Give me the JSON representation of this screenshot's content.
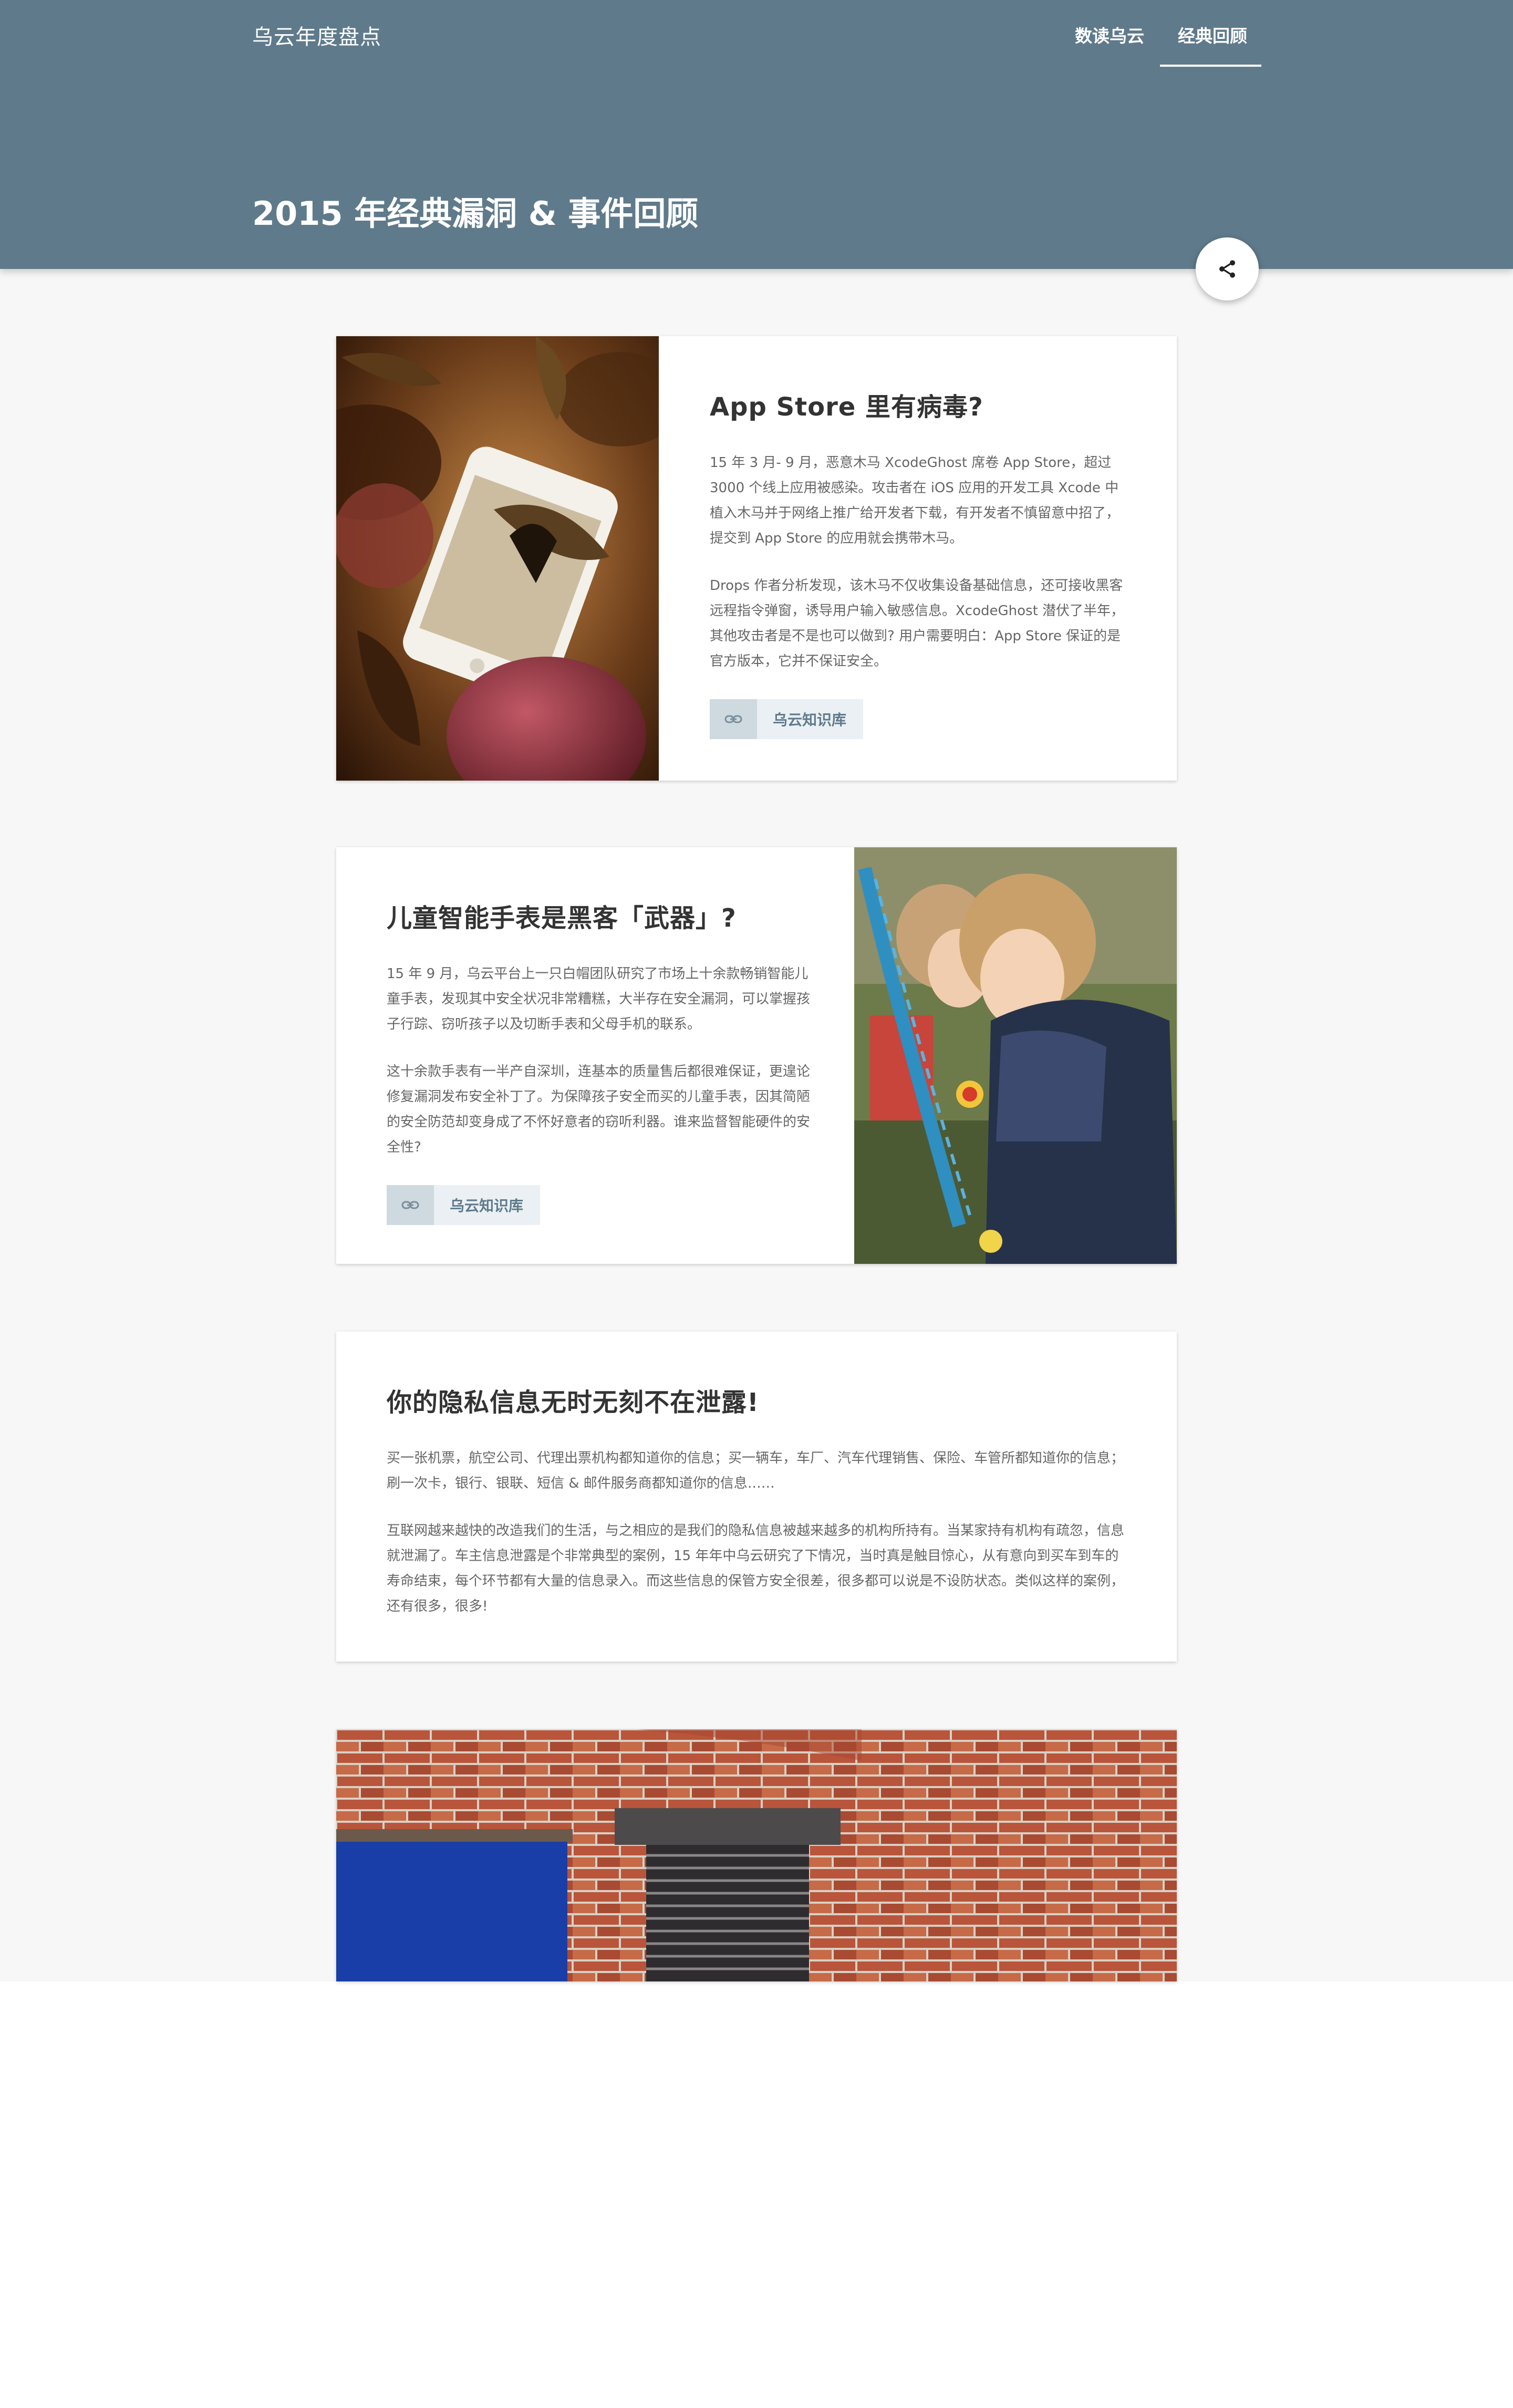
{
  "header": {
    "brand": "乌云年度盘点",
    "nav": [
      "数读乌云",
      "经典回顾"
    ],
    "active_nav": "经典回顾",
    "title": "2015 年经典漏洞 & 事件回顾"
  },
  "share": {
    "icon": "share-icon"
  },
  "cards": [
    {
      "title": "App Store 里有病毒?",
      "paragraphs": [
        "15 年 3 月- 9 月，恶意木马 XcodeGhost 席卷 App Store，超过 3000 个线上应用被感染。攻击者在 iOS 应用的开发工具 Xcode 中植入木马并于网络上推广给开发者下载，有开发者不慎留意中招了，提交到 App Store 的应用就会携带木马。",
        "Drops 作者分析发现，该木马不仅收集设备基础信息，还可接收黑客远程指令弹窗，诱导用户输入敏感信息。XcodeGhost 潜伏了半年，其他攻击者是不是也可以做到? 用户需要明白：App Store 保证的是官方版本，它并不保证安全。"
      ],
      "button_label": "乌云知识库",
      "image": "iphone-among-apples-photo"
    },
    {
      "title": "儿童智能手表是黑客「武器」?",
      "paragraphs": [
        "15 年 9 月，乌云平台上一只白帽团队研究了市场上十余款畅销智能儿童手表，发现其中安全状况非常糟糕，大半存在安全漏洞，可以掌握孩子行踪、窃听孩子以及切断手表和父母手机的联系。",
        "这十余款手表有一半产自深圳，连基本的质量售后都很难保证，更遑论修复漏洞发布安全补丁了。为保障孩子安全而买的儿童手表，因其简陋的安全防范却变身成了不怀好意者的窃听利器。谁来监督智能硬件的安全性?"
      ],
      "button_label": "乌云知识库",
      "image": "children-with-smartwatch-photo"
    },
    {
      "title": "你的隐私信息无时无刻不在泄露!",
      "paragraphs": [
        "买一张机票，航空公司、代理出票机构都知道你的信息；买一辆车，车厂、汽车代理销售、保险、车管所都知道你的信息；刷一次卡，银行、银联、短信 & 邮件服务商都知道你的信息……",
        "互联网越来越快的改造我们的生活，与之相应的是我们的隐私信息被越来越多的机构所持有。当某家持有机构有疏忽，信息就泄漏了。车主信息泄露是个非常典型的案例，15 年年中乌云研究了下情况，当时真是触目惊心，从有意向到买车到车的寿命结束，每个环节都有大量的信息录入。而这些信息的保管方安全很差，很多都可以说是不设防状态。类似这样的案例，还有很多，很多!"
      ]
    },
    {
      "image": "brick-wall-with-vent-photo"
    }
  ],
  "colors": {
    "header_bg": "#5f7a8b",
    "page_bg": "#f7f7f7",
    "button_icon_bg": "#cfdae0",
    "button_label_bg": "#eaf0f3"
  }
}
